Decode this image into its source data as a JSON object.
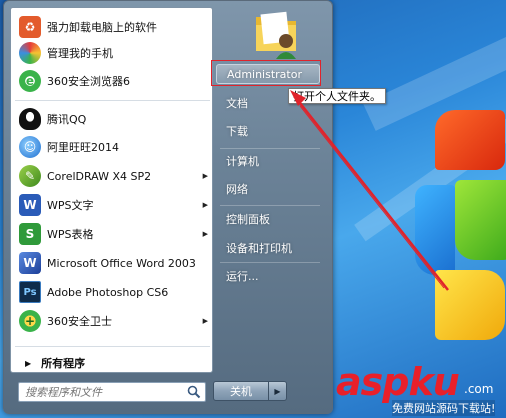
{
  "programs": [
    {
      "label": "强力卸载电脑上的软件",
      "icon": "uninstall-icon",
      "color": "#e35b2c"
    },
    {
      "label": "管理我的手机",
      "icon": "phone-manager-icon",
      "color": "#4aa3e0"
    },
    {
      "label": "360安全浏览器6",
      "icon": "browser-icon",
      "color": "#3ab34a"
    },
    {
      "label": "腾讯QQ",
      "icon": "qq-icon",
      "color": "#222222"
    },
    {
      "label": "阿里旺旺2014",
      "icon": "wangwang-icon",
      "color": "#3a8fe0"
    },
    {
      "label": "CorelDRAW X4 SP2",
      "icon": "coreldraw-icon",
      "color": "#5aa02c"
    },
    {
      "label": "WPS文字",
      "icon": "wps-writer-icon",
      "color": "#2a5bb8",
      "glyph": "W"
    },
    {
      "label": "WPS表格",
      "icon": "wps-sheet-icon",
      "color": "#2f9a3a",
      "glyph": "S"
    },
    {
      "label": "Microsoft Office Word 2003",
      "icon": "word-icon",
      "color": "#2b5fbf",
      "glyph": "W"
    },
    {
      "label": "Adobe Photoshop CS6",
      "icon": "photoshop-icon",
      "color": "#0f2c4a",
      "glyph": "Ps"
    },
    {
      "label": "360安全卫士",
      "icon": "security-guard-icon",
      "color": "#3ab34a",
      "glyph": "+"
    }
  ],
  "all_programs": "所有程序",
  "search": {
    "placeholder": "搜索程序和文件"
  },
  "right_items": [
    {
      "label": "Administrator"
    },
    {
      "label": "文档"
    },
    {
      "label": "下载"
    },
    {
      "label": "计算机"
    },
    {
      "label": "网络"
    },
    {
      "label": "控制面板"
    },
    {
      "label": "设备和打印机"
    },
    {
      "label": "运行..."
    }
  ],
  "tooltip": "打开个人文件夹。",
  "shutdown": {
    "label": "关机"
  },
  "watermark": {
    "main": "aspku",
    "suffix": ".com",
    "sub": "免费网站源码下载站!"
  },
  "colors": {
    "highlight_box": "#e0232b",
    "arrow": "#e0232b"
  }
}
